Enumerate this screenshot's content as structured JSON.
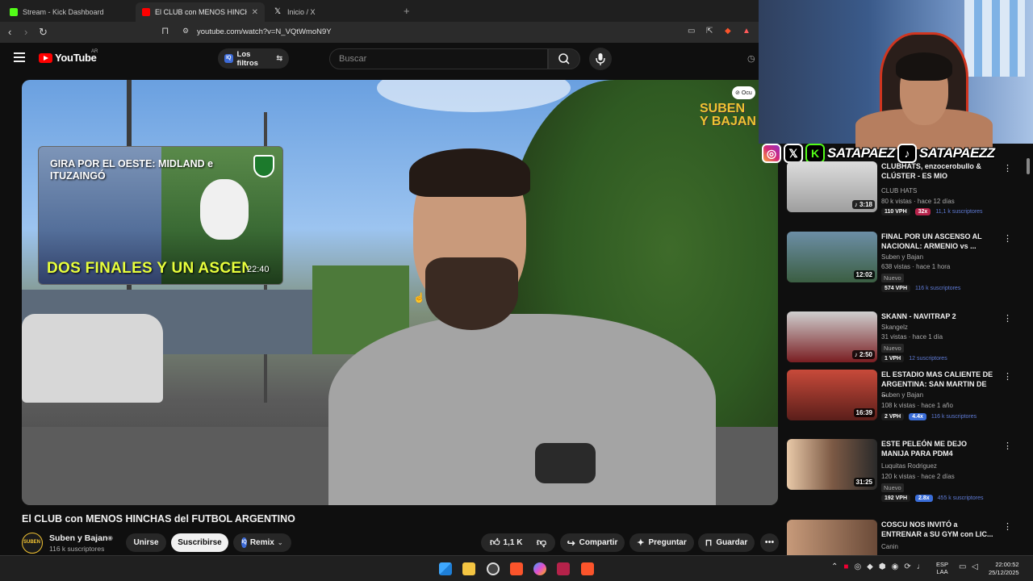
{
  "browser": {
    "tabs": [
      {
        "label": "Stream - Kick Dashboard",
        "favicon_color": "#53fc18"
      },
      {
        "label": "El CLUB con MENOS HINCHAS d",
        "favicon_color": "#ff0000"
      },
      {
        "label": "Inicio / X",
        "favicon_color": "#ffffff"
      }
    ],
    "url": "youtube.com/watch?v=N_VQtWmoN9Y"
  },
  "youtube": {
    "wordmark": "YouTube",
    "region": "AR",
    "filters_label": "Los filtros",
    "filters_tag": "IQ",
    "search_placeholder": "Buscar"
  },
  "player": {
    "hide_badge": "Ocu",
    "watermark": "SUBEN Y BAJAN",
    "preview": {
      "title": "GIRA POR EL OESTE: MIDLAND e ITUZAINGÓ",
      "bottom_text": "DOS FINALES Y UN ASCENSO",
      "duration": "22:40"
    }
  },
  "video": {
    "title": "El CLUB con MENOS HINCHAS del FUTBOL ARGENTINO",
    "channel": "Suben y Bajan",
    "channel_avatar": "SUBEN",
    "subscribers": "116 k suscriptores",
    "join_label": "Unirse",
    "subscribe_label": "Suscribirse",
    "remix_label": "Remix",
    "remix_tag": "IQ",
    "likes": "1,1 K",
    "share_label": "Compartir",
    "ask_label": "Preguntar",
    "save_label": "Guardar"
  },
  "social": {
    "handle_kick": "SATAPAEZ",
    "handle_tiktok": "SATAPAEZZ"
  },
  "recommendations": [
    {
      "title": "CLUBHATS, enzocerobullo & CLÚSTER - ES MIO",
      "channel": "CLUB HATS",
      "meta": "80 k vistas · hace 12 días",
      "duration": "3:18",
      "vph": "110 VPH",
      "mult": "32x",
      "mult_color": "red",
      "subs": "11,1 k suscriptores",
      "is_new": false,
      "thumb_color": "#c8c8c8"
    },
    {
      "title": "FINAL POR UN ASCENSO AL NACIONAL: ARMENIO vs ...",
      "channel": "Suben y Bajan",
      "meta": "638 vistas · hace 1 hora",
      "duration": "12:02",
      "vph": "574 VPH",
      "mult": "",
      "subs": "116 k suscriptores",
      "is_new": true,
      "new_label": "Nuevo",
      "thumb_color": "#5a7d96"
    },
    {
      "title": "SKANN - NAVITRAP 2",
      "channel": "Skangelz",
      "meta": "31 vistas · hace 1 día",
      "duration": "2:50",
      "vph": "1 VPH",
      "mult": "",
      "subs": "12 suscriptores",
      "is_new": true,
      "new_label": "Nuevo",
      "thumb_color": "#6e1f24"
    },
    {
      "title": "EL ESTADIO MAS CALIENTE DE ARGENTINA: SAN MARTIN DE ...",
      "channel": "Suben y Bajan",
      "meta": "108 k vistas · hace 1 año",
      "duration": "16:39",
      "vph": "2 VPH",
      "mult": "4.4x",
      "mult_color": "blue",
      "subs": "116 k suscriptores",
      "is_new": false,
      "thumb_color": "#a0302b"
    },
    {
      "title": "ESTE PELEÓN ME DEJO MANIJA PARA PDM4",
      "channel": "Luquitas Rodriguez",
      "meta": "120 k vistas · hace 2 días",
      "duration": "31:25",
      "vph": "192 VPH",
      "mult": "2.8x",
      "mult_color": "blue",
      "subs": "455 k suscriptores",
      "is_new": true,
      "new_label": "Nuevo",
      "thumb_color": "#b88565"
    },
    {
      "title": "COSCU NOS INVITÓ a ENTRENAR a SU GYM con LIC...",
      "channel": "Canin",
      "meta": "",
      "duration": "",
      "vph": "",
      "mult": "",
      "subs": "",
      "is_new": false,
      "thumb_color": "#8a6a55"
    }
  ],
  "taskbar": {
    "lang_top": "ESP",
    "lang_bottom": "LAA",
    "time": "22:00:52",
    "date": "25/12/2025"
  }
}
